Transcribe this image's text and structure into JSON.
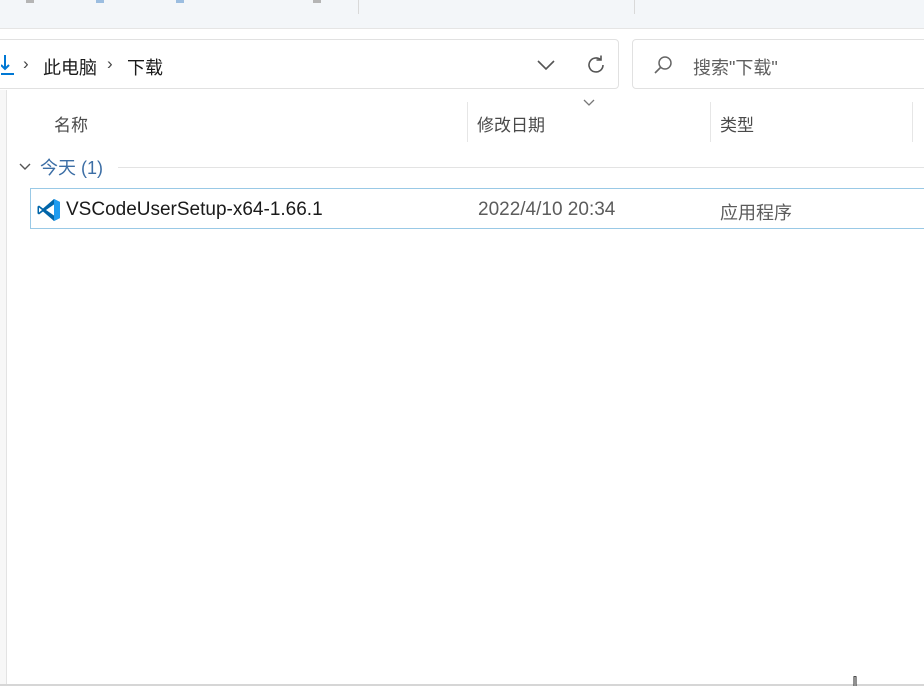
{
  "address_bar": {
    "crumbs": [
      "此电脑",
      "下载"
    ],
    "separator": "›"
  },
  "search": {
    "placeholder": "搜索\"下载\""
  },
  "columns": {
    "name": "名称",
    "modified": "修改日期",
    "type": "类型"
  },
  "group": {
    "label": "今天 (1)"
  },
  "files": [
    {
      "name": "VSCodeUserSetup-x64-1.66.1",
      "modified": "2022/4/10 20:34",
      "type": "应用程序",
      "icon": "vscode-icon"
    }
  ],
  "colors": {
    "accent": "#0078d4",
    "selection_border": "#99c9e6",
    "group_label": "#3c6ea5",
    "vscode_blue": "#0065a9"
  }
}
